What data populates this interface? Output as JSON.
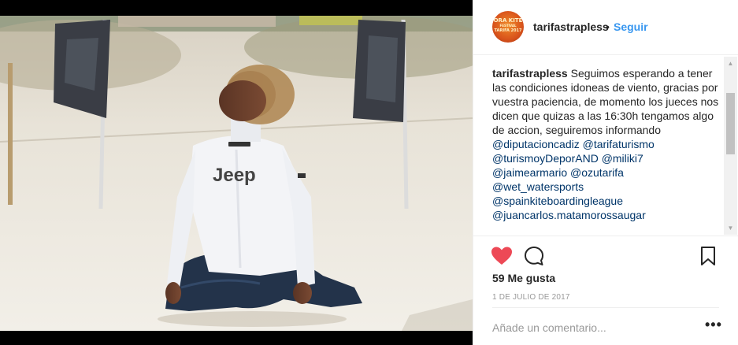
{
  "post": {
    "username": "tarifastrapless",
    "separator": "•",
    "follow_label": "Seguir",
    "avatar_lines": [
      "ORA KITE",
      "FESTIVAL",
      "TARIFA 2017"
    ],
    "caption_user": "tarifastrapless",
    "caption_text": "Seguimos esperando a tener las condiciones idoneas de viento, gracias por vuestra paciencia, de momento los jueces nos dicen que quizas a las 16:30h tengamos algo de accion, seguiremos informando",
    "hashtags": [
      "@diputacioncadiz @tarifaturismo",
      "@turismoyDeporAND @miliki7",
      "@jaimearmario @ozutarifa",
      "@wet_watersports",
      "@spainkiteboardingleague",
      "@juancarlos.matamorossaugar"
    ],
    "likes": "59 Me gusta",
    "date": "1 DE JULIO DE 2017",
    "comment_placeholder": "Añade un comentario...",
    "more_label": "•••"
  },
  "photo": {
    "banner_text": "Jeep"
  },
  "icons": {
    "like": "heart-icon",
    "comment": "comment-icon",
    "save": "bookmark-icon",
    "more": "more-options-icon"
  },
  "colors": {
    "like_active": "#ed4956",
    "link": "#3897f0",
    "mention": "#003569",
    "muted": "#999999"
  }
}
